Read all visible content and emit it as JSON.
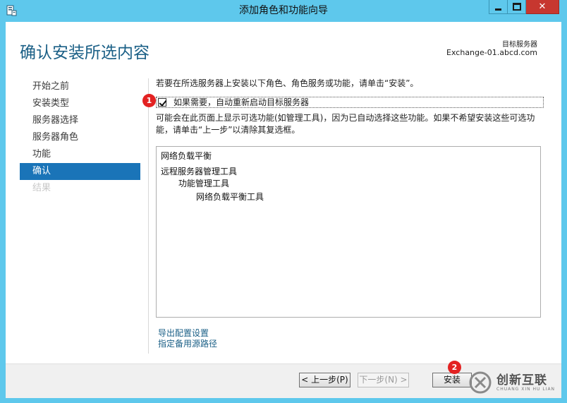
{
  "window": {
    "title": "添加角色和功能向导",
    "close_glyph": "✕"
  },
  "header": {
    "page_title": "确认安装所选内容",
    "target_label": "目标服务器",
    "target_value": "Exchange-01.abcd.com"
  },
  "nav": {
    "items": [
      {
        "label": "开始之前",
        "state": "normal"
      },
      {
        "label": "安装类型",
        "state": "normal"
      },
      {
        "label": "服务器选择",
        "state": "normal"
      },
      {
        "label": "服务器角色",
        "state": "normal"
      },
      {
        "label": "功能",
        "state": "normal"
      },
      {
        "label": "确认",
        "state": "active"
      },
      {
        "label": "结果",
        "state": "disabled"
      }
    ]
  },
  "content": {
    "intro": "若要在所选服务器上安装以下角色、角色服务或功能，请单击“安装”。",
    "restart_checkbox": {
      "label": "如果需要，自动重新启动目标服务器",
      "checked": true
    },
    "note": "可能会在此页面上显示可选功能(如管理工具)，因为已自动选择这些功能。如果不希望安装这些可选功能，请单击“上一步”以清除其复选框。",
    "list": [
      {
        "text": "网络负载平衡",
        "level": 0
      },
      {
        "text": "远程服务器管理工具",
        "level": 0
      },
      {
        "text": "功能管理工具",
        "level": 1
      },
      {
        "text": "网络负载平衡工具",
        "level": 2
      }
    ],
    "links": {
      "export": "导出配置设置",
      "alt_source": "指定备用源路径"
    }
  },
  "footer": {
    "prev_label": "< 上一步(P)",
    "next_label": "下一步(N) >",
    "install_label": "安装"
  },
  "annotations": {
    "badge_1": "1",
    "badge_2": "2"
  },
  "watermark": {
    "cn": "创新互联",
    "en": "CHUANG XIN HU LIAN"
  },
  "colors": {
    "titlebar": "#5ec8ec",
    "accent": "#1a74b8",
    "title_text": "#1a5f86",
    "close_button": "#c7372f",
    "badge": "#e32222"
  }
}
